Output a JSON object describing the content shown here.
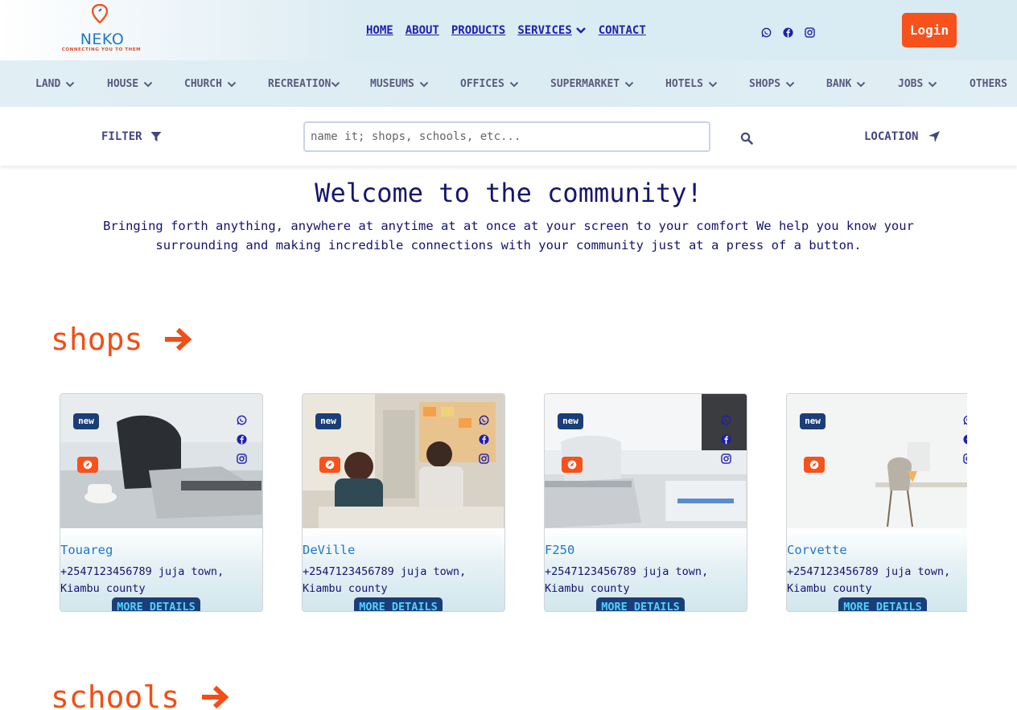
{
  "brand": {
    "name": "NEKO",
    "tagline": "CONNECTING YOU TO THEM"
  },
  "nav": {
    "home": "HOME",
    "about": "ABOUT",
    "products": "PRODUCTS",
    "services": "SERVICES",
    "contact": "CONTACT"
  },
  "top_social": [
    "whatsapp-icon",
    "facebook-icon",
    "instagram-icon"
  ],
  "login_label": "Login",
  "categories": [
    "LAND",
    "HOUSE",
    "CHURCH",
    "RECREATION",
    "MUSEUMS",
    "OFFICES",
    "SUPERMARKET",
    "HOTELS",
    "SHOPS",
    "BANK",
    "JOBS",
    "OTHERS"
  ],
  "filter_label": "FILTER",
  "search": {
    "placeholder": "name it; shops, schools, etc..."
  },
  "location_label": "LOCATION",
  "hero": {
    "title": "Welcome to the community!",
    "text": "Bringing forth anything, anywhere at anytime at at once at your screen to your comfort We help you know your surrounding and making incredible connections with your community just at a press of a button."
  },
  "sections": {
    "shops": "shops",
    "schools": "schools"
  },
  "cards": [
    {
      "badge": "new",
      "name": "Touareg",
      "address": "+2547123456789 juja town, Kiambu county",
      "button": "MORE DETAILS"
    },
    {
      "badge": "new",
      "name": "DeVille",
      "address": "+2547123456789 juja town, Kiambu county",
      "button": "MORE DETAILS"
    },
    {
      "badge": "new",
      "name": "F250",
      "address": "+2547123456789 juja town, Kiambu county",
      "button": "MORE DETAILS"
    },
    {
      "badge": "new",
      "name": "Corvette",
      "address": "+2547123456789 juja town, Kiambu county",
      "button": "MORE DETAILS"
    }
  ],
  "colors": {
    "accent": "#f7511c",
    "navy": "#1a3e78",
    "link": "#1f1faa",
    "bar": "#dcecf3"
  }
}
